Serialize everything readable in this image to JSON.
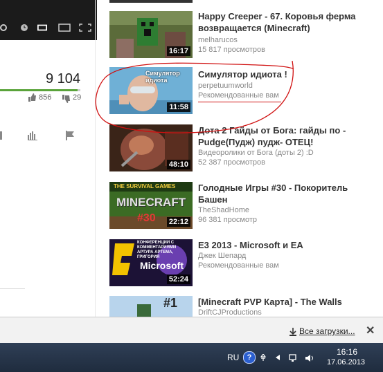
{
  "player": {
    "view_count": "9 104",
    "like_count": "856",
    "dislike_count": "29",
    "like_ratio": 0.967
  },
  "sidebar": {
    "videos": [
      {
        "title": "Happy Creeper - 67. Коровья ферма возвращается (Minecraft)",
        "channel": "melharucos",
        "views": "15 817 просмотров",
        "duration": "16:17"
      },
      {
        "title": "Симулятор идиота !",
        "channel": "perpetuumworld",
        "recommended": "Рекомендованные вам",
        "duration": "11:58",
        "thumb_text": "Симулятор идиота"
      },
      {
        "title": "Дота 2 Гайды от Бога: гайды по - Pudge(Пудж) пудж- ОТЕЦ!",
        "channel": "Видеоролики от Бога (доты 2) :D",
        "views": "52 387 просмотров",
        "duration": "48:10"
      },
      {
        "title": "Голодные Игры #30 - Покоритель Башен",
        "channel": "TheShadHome",
        "views": "96 381 просмотр",
        "duration": "22:12",
        "thumb_top": "THE SURVIVAL GAMES",
        "thumb_mid": "MINECRAFT",
        "thumb_num": "#30"
      },
      {
        "title": "E3 2013 - Microsoft и EA",
        "channel": "Джек Шепард",
        "recommended": "Рекомендованные вам",
        "duration": "52:24",
        "thumb_top": "КОНФЕРЕНЦИИ С КОММЕНТАРИЯМИ АРТУРА АРТЕМА, ГРИГОРИЯ",
        "thumb_mid": "Microsoft"
      },
      {
        "title": "[Minecraft PVP Карта] - The Walls",
        "channel": "DriftCJProductions",
        "thumb_num": "#1"
      }
    ]
  },
  "downloads": {
    "all_label": "Все загрузки...",
    "close": "✕"
  },
  "taskbar": {
    "lang": "RU",
    "help": "?",
    "time": "16:16",
    "date": "17.06.2013"
  },
  "colors": {
    "annotation": "#d01010",
    "like_green": "#5aa33a",
    "taskbar": "#243247"
  }
}
